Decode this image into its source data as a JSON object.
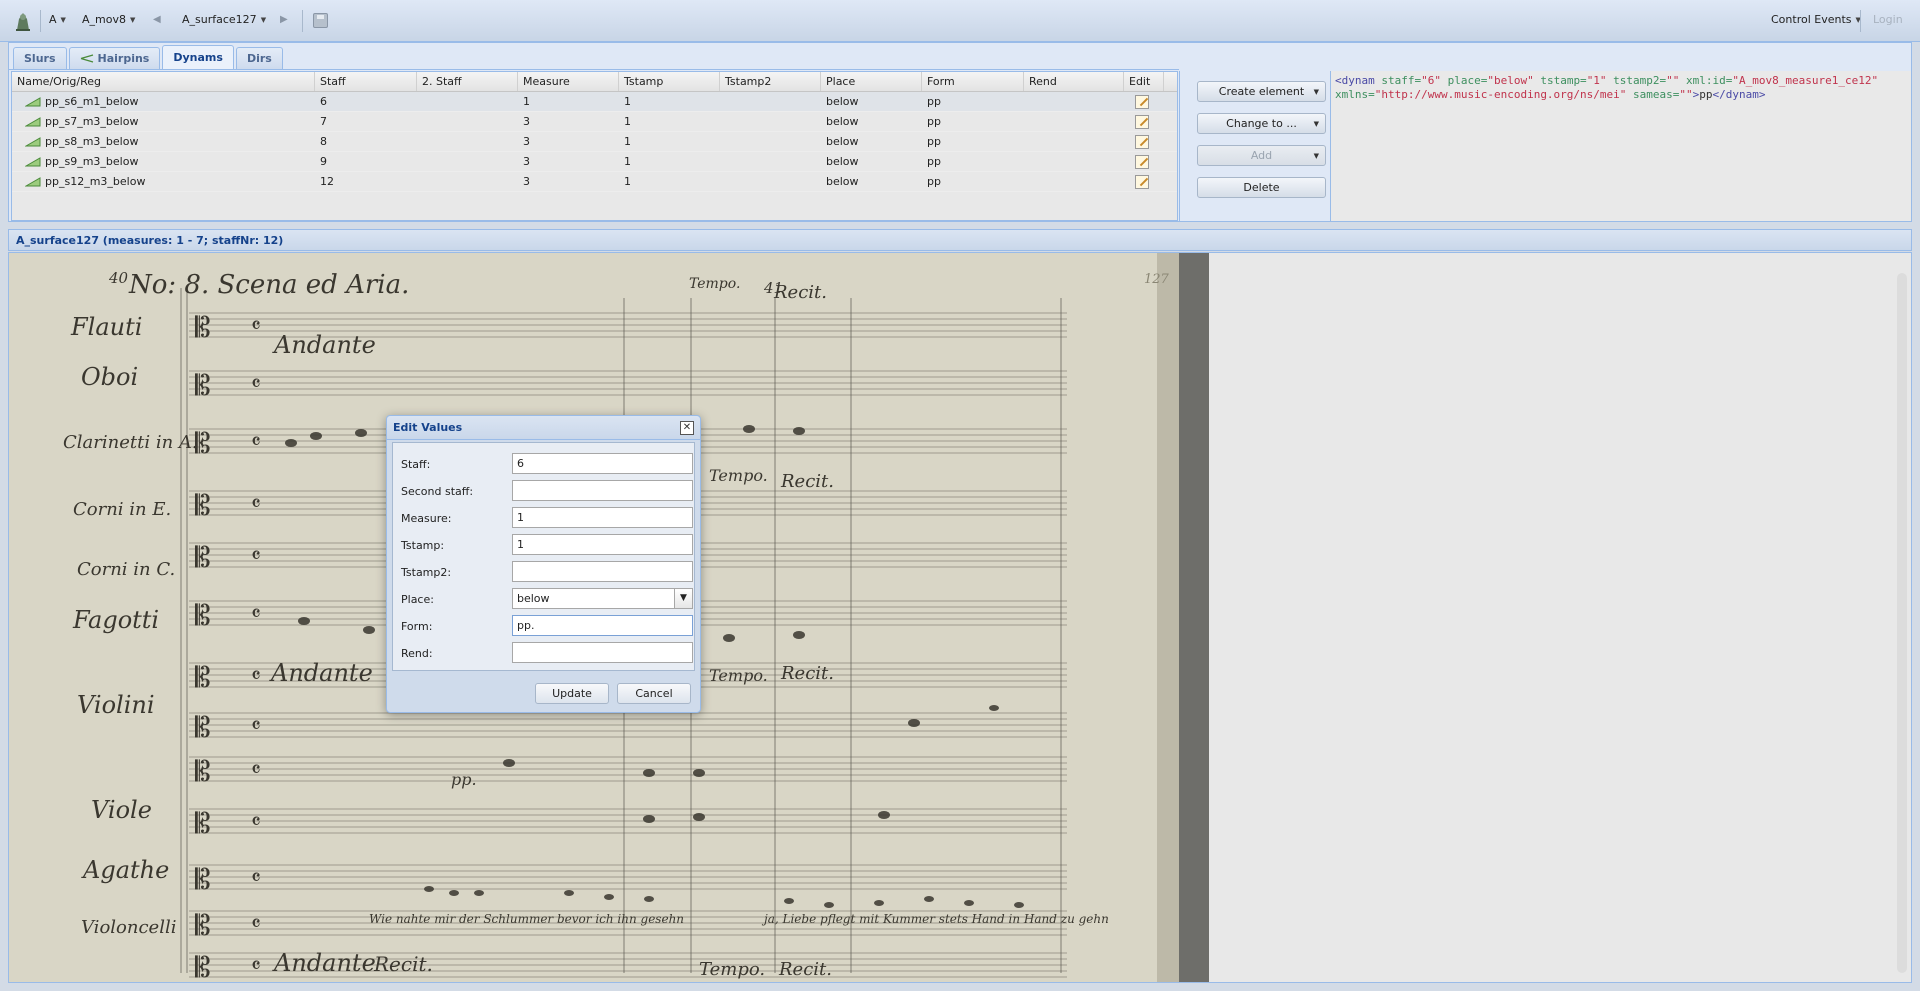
{
  "toolbar": {
    "source": "A",
    "movement": "A_mov8",
    "surface": "A_surface127",
    "control_events": "Control Events",
    "login": "Login"
  },
  "tabs": [
    {
      "label": "Slurs"
    },
    {
      "label": "Hairpins"
    },
    {
      "label": "Dynams"
    },
    {
      "label": "Dirs"
    }
  ],
  "grid": {
    "columns": [
      "Name/Orig/Reg",
      "Staff",
      "2. Staff",
      "Measure",
      "Tstamp",
      "Tstamp2",
      "Place",
      "Form",
      "Rend",
      "Edit"
    ],
    "rows": [
      {
        "name": "pp_s6_m1_below",
        "staff": "6",
        "staff2": "",
        "measure": "1",
        "tstamp": "1",
        "tstamp2": "",
        "place": "below",
        "form": "pp",
        "rend": ""
      },
      {
        "name": "pp_s7_m3_below",
        "staff": "7",
        "staff2": "",
        "measure": "3",
        "tstamp": "1",
        "tstamp2": "",
        "place": "below",
        "form": "pp",
        "rend": ""
      },
      {
        "name": "pp_s8_m3_below",
        "staff": "8",
        "staff2": "",
        "measure": "3",
        "tstamp": "1",
        "tstamp2": "",
        "place": "below",
        "form": "pp",
        "rend": ""
      },
      {
        "name": "pp_s9_m3_below",
        "staff": "9",
        "staff2": "",
        "measure": "3",
        "tstamp": "1",
        "tstamp2": "",
        "place": "below",
        "form": "pp",
        "rend": ""
      },
      {
        "name": "pp_s12_m3_below",
        "staff": "12",
        "staff2": "",
        "measure": "3",
        "tstamp": "1",
        "tstamp2": "",
        "place": "below",
        "form": "pp",
        "rend": ""
      }
    ]
  },
  "actions": {
    "create": "Create element",
    "change": "Change to ...",
    "add": "Add",
    "delete": "Delete"
  },
  "xml": {
    "open": "<dynam",
    "a_staff": " staff=",
    "v_staff": "\"6\"",
    "a_place": " place=",
    "v_place": "\"below\"",
    "a_tstamp": " tstamp=",
    "v_tstamp": "\"1\"",
    "a_tstamp2": " tstamp2=",
    "v_tstamp2": "\"\"",
    "a_id": " xml:id=",
    "v_id": "\"A_mov8_measure1_ce12\"",
    "a_xmlns": "xmlns=",
    "v_xmlns": "\"http://www.music-encoding.org/ns/mei\"",
    "a_sameas": " sameas=",
    "v_sameas": "\"\"",
    "close_open": ">",
    "text": "pp",
    "close": "</dynam>"
  },
  "lower_title": "A_surface127 (measures: 1 - 7; staffNr: 12)",
  "dialog": {
    "title": "Edit Values",
    "fields": [
      {
        "label": "Staff:",
        "value": "6"
      },
      {
        "label": "Second staff:",
        "value": ""
      },
      {
        "label": "Measure:",
        "value": "1"
      },
      {
        "label": "Tstamp:",
        "value": "1"
      },
      {
        "label": "Tstamp2:",
        "value": ""
      },
      {
        "label": "Place:",
        "value": "below"
      },
      {
        "label": "Form:",
        "value": "pp."
      },
      {
        "label": "Rend:",
        "value": ""
      }
    ],
    "update": "Update",
    "cancel": "Cancel"
  },
  "score": {
    "title": "No: 8. Scena ed Aria.",
    "page_number_left": "40",
    "page_number_mid": "41",
    "page_number_right": "127",
    "instruments": [
      "Flauti",
      "Oboi",
      "Clarinetti in A.",
      "Corni in E.",
      "Corni in C.",
      "Fagotti",
      "Violini",
      "Viole",
      "Agathe",
      "Violoncelli"
    ],
    "tempo_andante": "Andante",
    "tempo_recit": "Recit.",
    "tempo_tempo": "Tempo.",
    "dynamic_pp": "pp.",
    "lyrics_1": "Wie nahte mir der Schlummer bevor ich ihn gesehn",
    "lyrics_2": "ja, Liebe pflegt mit Kummer stets Hand in Hand zu gehn"
  },
  "colors": {
    "accent": "#15428b",
    "panel_bg": "#dfe8f6",
    "border": "#99bbe8",
    "paper": "#d9d6c6"
  }
}
